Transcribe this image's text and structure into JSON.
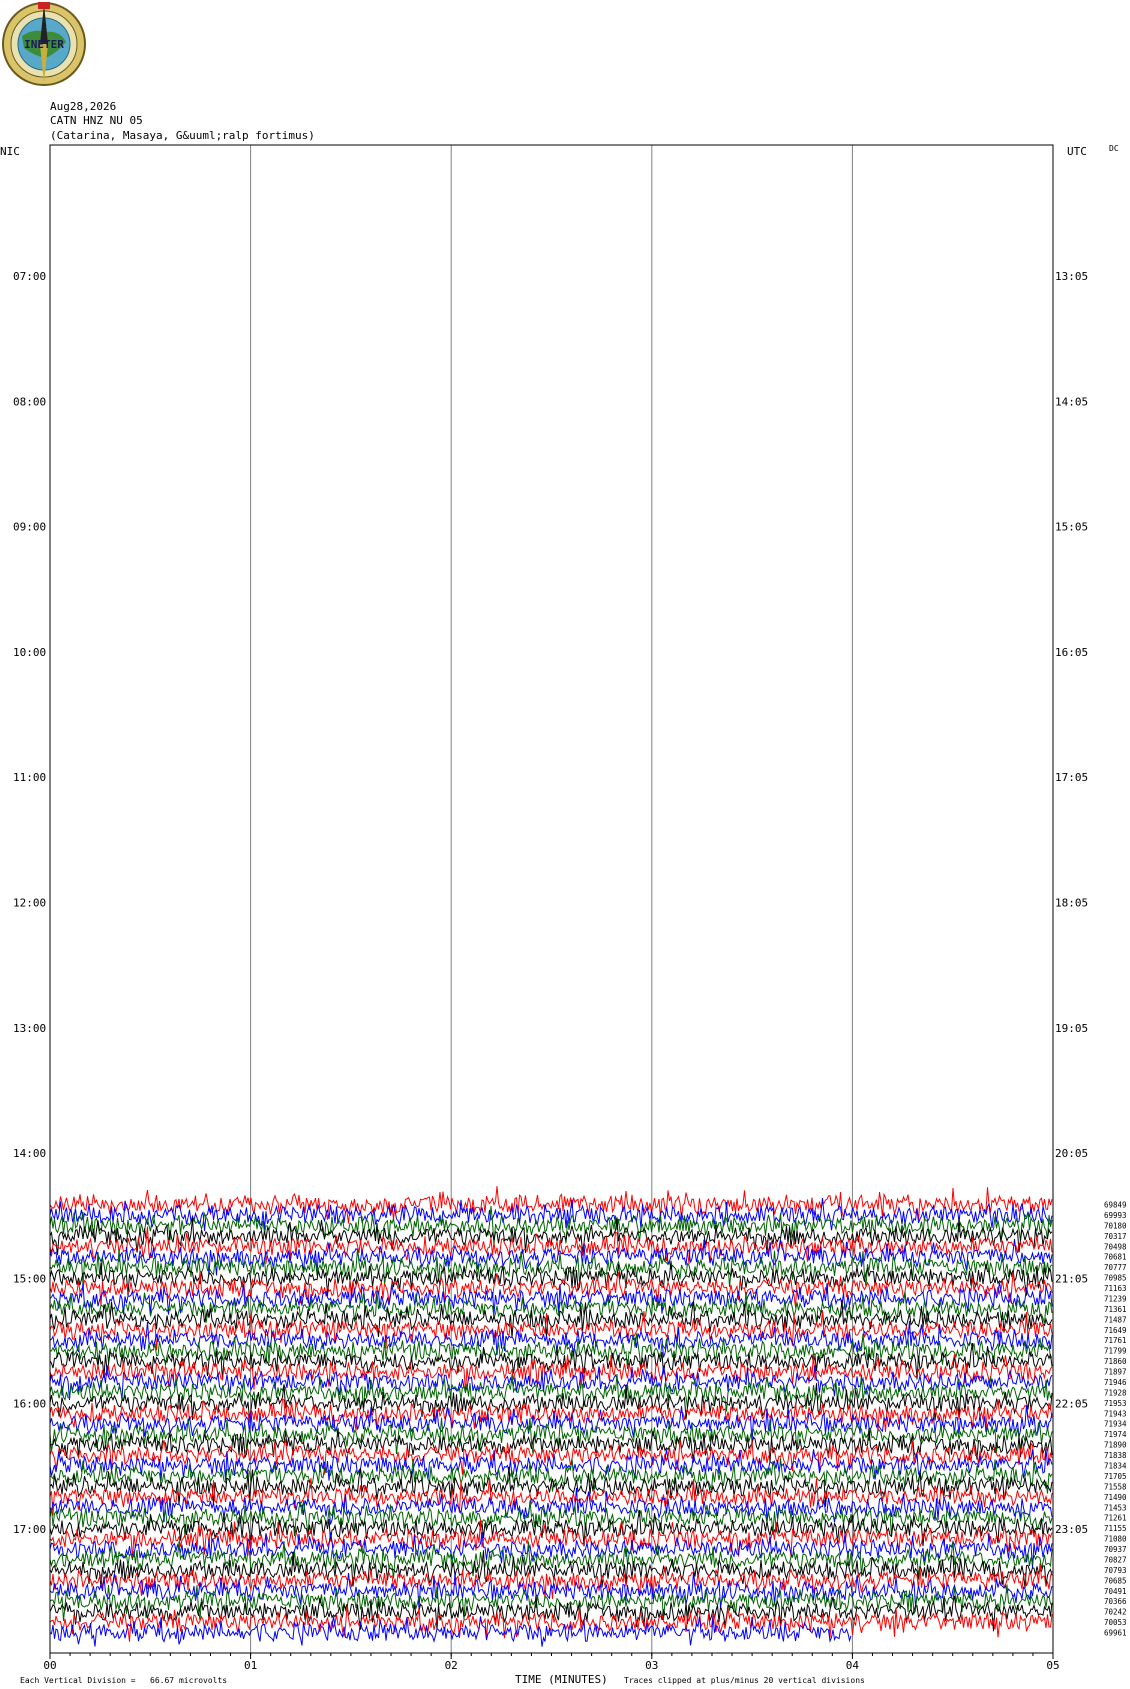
{
  "header": {
    "logo_text": "INETER",
    "date": "Aug28,2026",
    "station": "CATN HNZ NU 05",
    "location": "(Catarina, Masaya, G&uuml;ralp fortimus)"
  },
  "labels": {
    "left_tz": "NIC",
    "right_tz": "UTC",
    "dc": "DC",
    "footer_division": "Each Vertical Division =   66.67 microvolts",
    "footer_axis": "TIME (MINUTES)",
    "footer_clip": "Traces clipped at plus/minus 20 vertical divisions"
  },
  "chart_data": {
    "type": "line",
    "title": "",
    "xlabel": "TIME (MINUTES)",
    "xlim": [
      0,
      5
    ],
    "x_ticks": [
      "00",
      "01",
      "02",
      "03",
      "04",
      "05"
    ],
    "left_time_labels": [
      "07:00",
      "08:00",
      "09:00",
      "10:00",
      "11:00",
      "12:00",
      "13:00",
      "14:00",
      "15:00",
      "16:00",
      "17:00"
    ],
    "right_time_labels": [
      "13:05",
      "14:05",
      "15:05",
      "16:05",
      "17:05",
      "18:05",
      "19:05",
      "20:05",
      "21:05",
      "22:05",
      "23:05"
    ],
    "trace_colors": [
      "#ff0000",
      "#0000ff",
      "#006400",
      "#000000"
    ],
    "trace_counts": [
      "69849",
      "69993",
      "70180",
      "70317",
      "70498",
      "70681",
      "70777",
      "70985",
      "71163",
      "71239",
      "71361",
      "71487",
      "71649",
      "71761",
      "71799",
      "71860",
      "71897",
      "71946",
      "71928",
      "71953",
      "71943",
      "71934",
      "71974",
      "71890",
      "71838",
      "71834",
      "71705",
      "71558",
      "71490",
      "71453",
      "71261",
      "71155",
      "71080",
      "70937",
      "70827",
      "70793",
      "70685",
      "70491",
      "70366",
      "70242",
      "70053",
      "69961"
    ],
    "grid": "vertical lines at each minute",
    "division_microvolts": 66.67
  }
}
